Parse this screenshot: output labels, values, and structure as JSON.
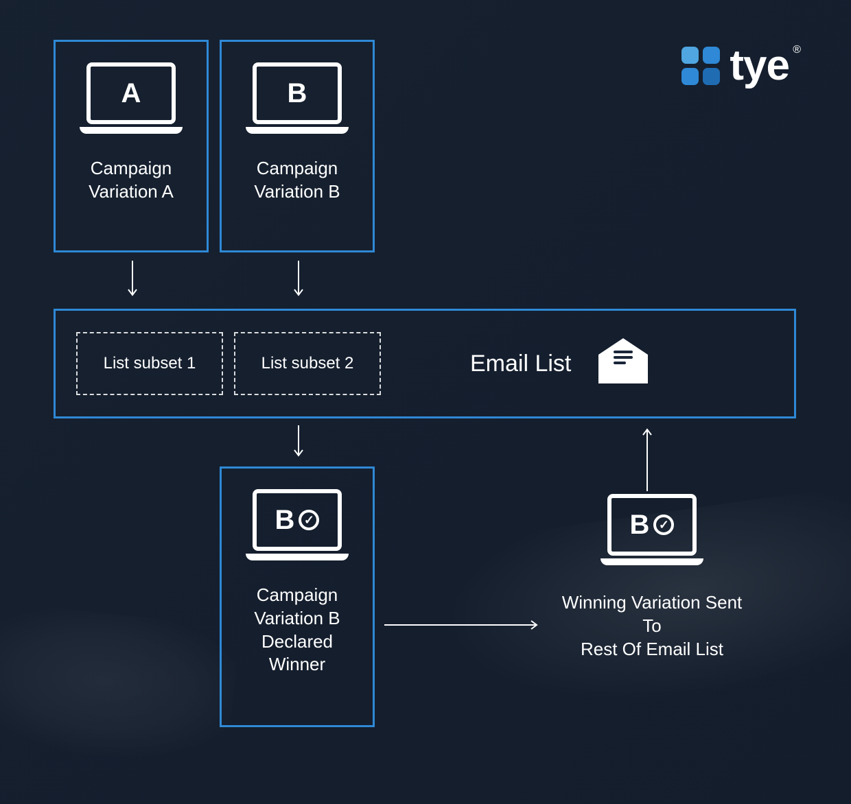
{
  "brand": {
    "name": "tye",
    "trademark": "®",
    "colors": {
      "accent_light": "#4FA6E0",
      "accent_mid": "#2F89D6",
      "accent_dark": "#1F6CB3"
    }
  },
  "nodes": {
    "variation_a": {
      "letter": "A",
      "caption_l1": "Campaign",
      "caption_l2": "Variation A"
    },
    "variation_b": {
      "letter": "B",
      "caption_l1": "Campaign",
      "caption_l2": "Variation B"
    },
    "subset1": "List subset 1",
    "subset2": "List subset 2",
    "email_list": "Email List",
    "winner": {
      "letter": "B",
      "caption_l1": "Campaign",
      "caption_l2": "Variation B",
      "caption_l3": "Declared",
      "caption_l4": "Winner"
    },
    "sending": {
      "letter": "B",
      "caption_l1": "Winning Variation Sent To",
      "caption_l2": "Rest Of Email List"
    }
  },
  "flow": [
    "variation_a -> subset1",
    "variation_b -> subset2",
    "subsets -> winner",
    "winner -> sending",
    "sending -> email_list"
  ]
}
